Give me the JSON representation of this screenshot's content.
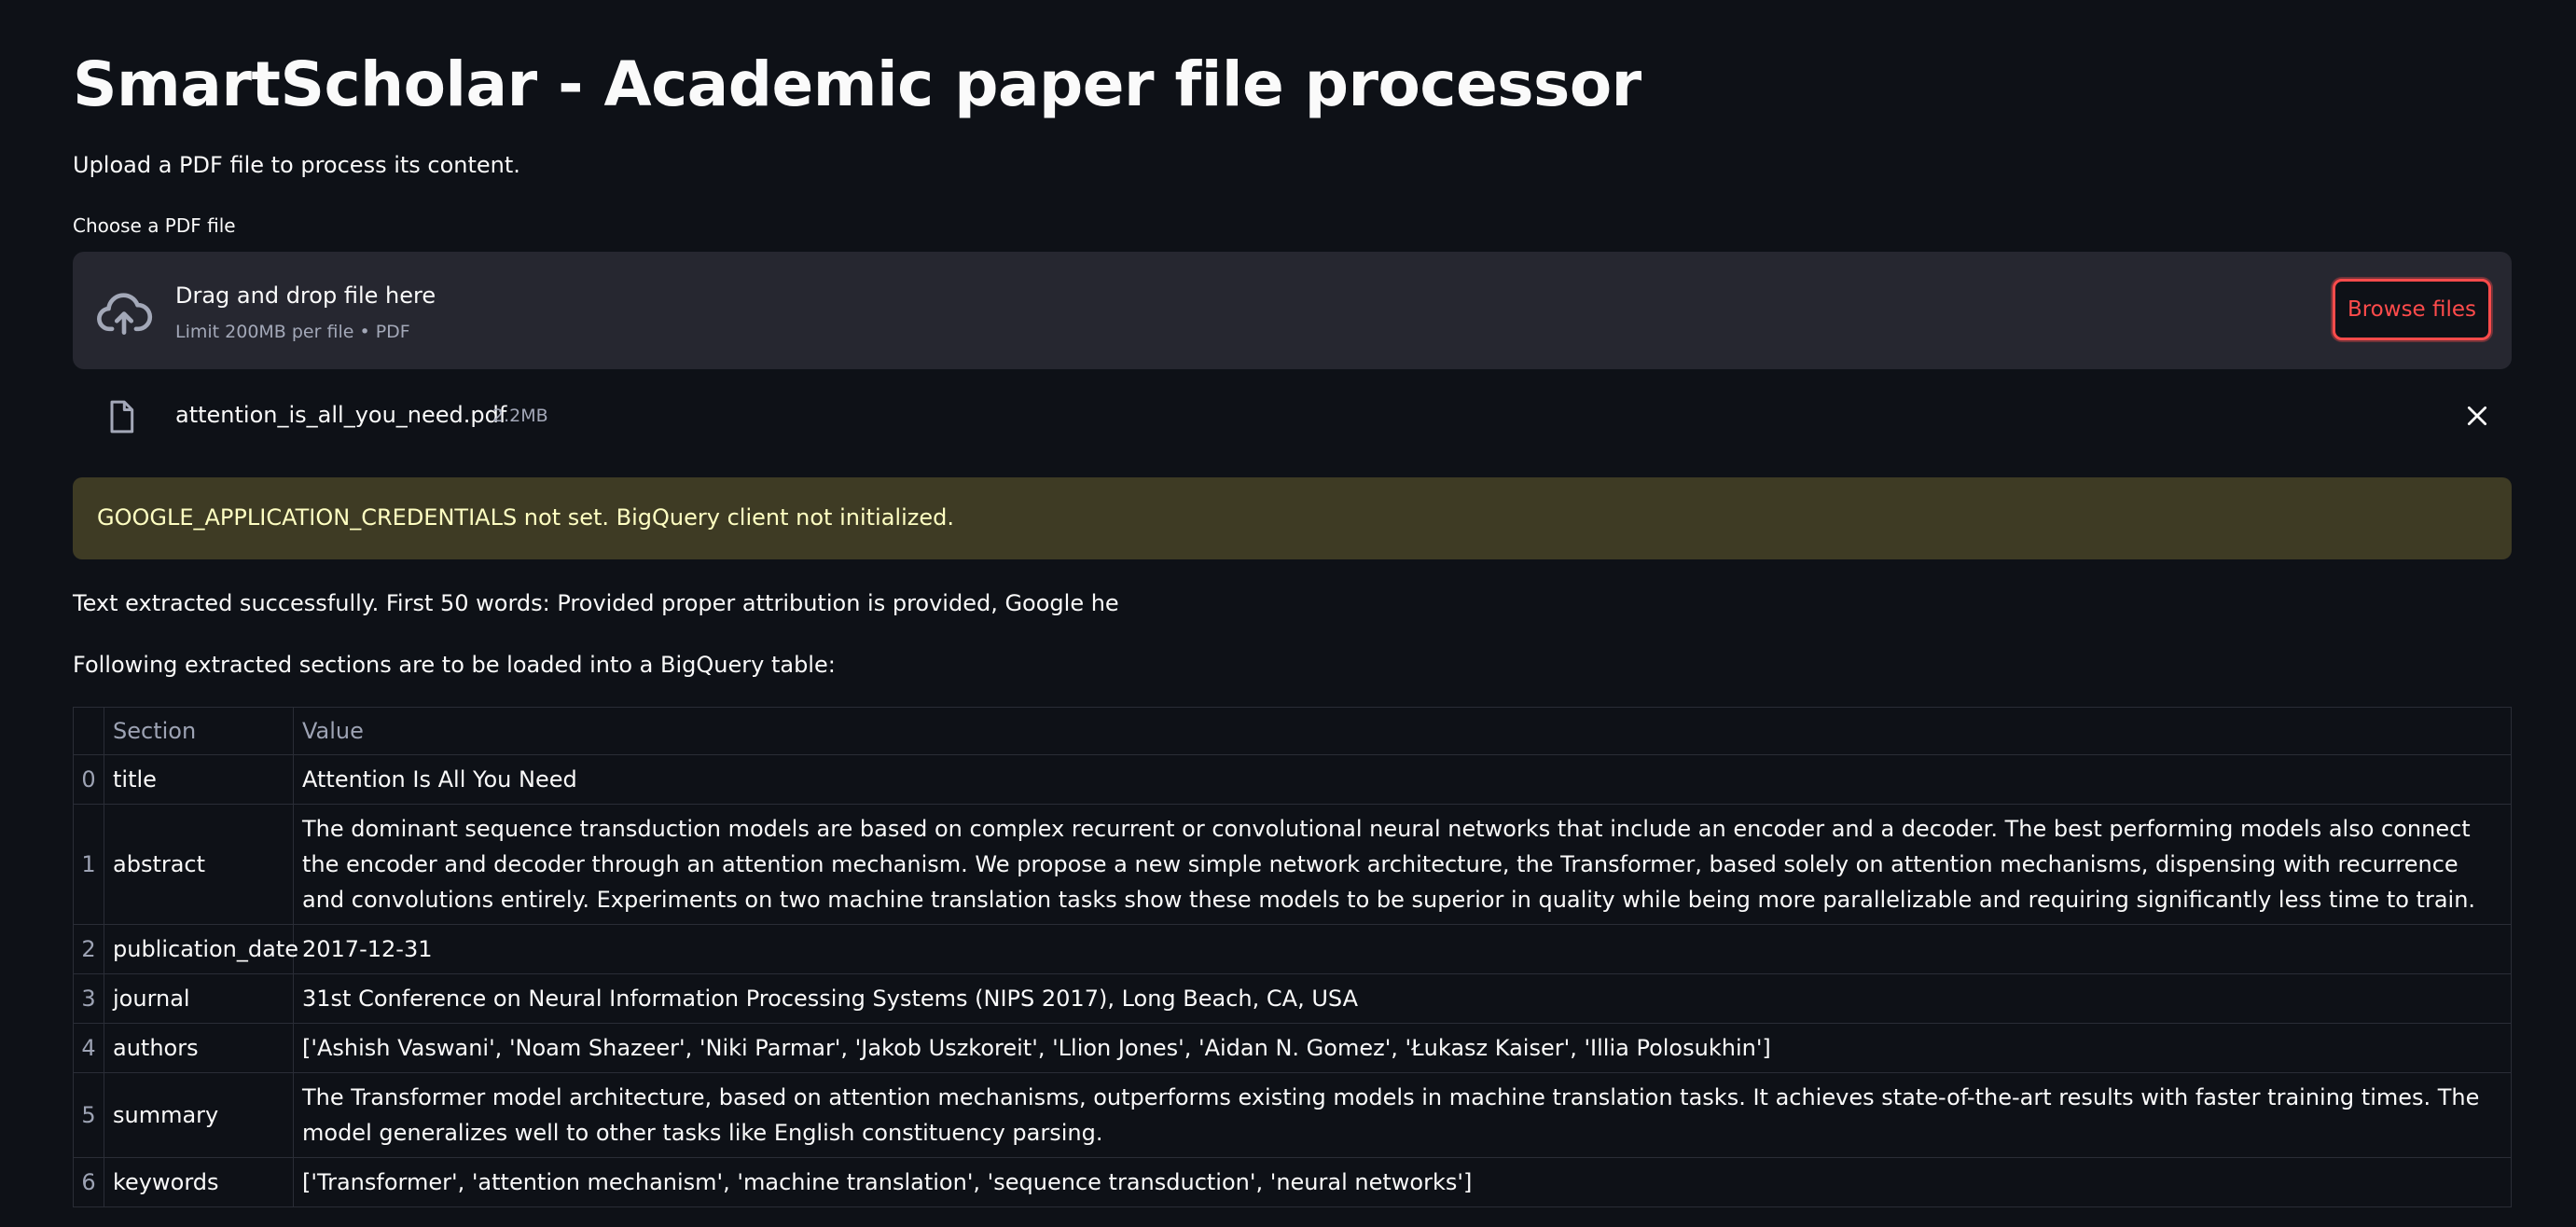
{
  "app": {
    "title": "SmartScholar - Academic paper file processor",
    "subtitle": "Upload a PDF file to process its content."
  },
  "uploader": {
    "label": "Choose a PDF file",
    "drop_title": "Drag and drop file here",
    "drop_limit": "Limit 200MB per file • PDF",
    "browse_label": "Browse files",
    "cloud_icon": "cloud-upload-icon"
  },
  "uploaded_file": {
    "icon": "file-icon",
    "name": "attention_is_all_you_need.pdf",
    "size": "2.2MB",
    "remove_icon": "close-icon"
  },
  "warning": {
    "text": "GOOGLE_APPLICATION_CREDENTIALS not set. BigQuery client not initialized.",
    "bg_color": "#3e3b24",
    "text_color": "#ffffc2"
  },
  "messages": {
    "extracted": "Text extracted successfully. First 50 words: Provided proper attribution is provided, Google he",
    "following": "Following extracted sections are to be loaded into a BigQuery table:"
  },
  "table": {
    "headers": [
      "",
      "Section",
      "Value"
    ],
    "rows": [
      {
        "index": "0",
        "section": "title",
        "value": "Attention Is All You Need"
      },
      {
        "index": "1",
        "section": "abstract",
        "value": "The dominant sequence transduction models are based on complex recurrent or convolutional neural networks that include an encoder and a decoder. The best performing models also connect the encoder and decoder through an attention mechanism. We propose a new simple network architecture, the Transformer, based solely on attention mechanisms, dispensing with recurrence and convolutions entirely. Experiments on two machine translation tasks show these models to be superior in quality while being more parallelizable and requiring significantly less time to train."
      },
      {
        "index": "2",
        "section": "publication_date",
        "value": "2017-12-31"
      },
      {
        "index": "3",
        "section": "journal",
        "value": "31st Conference on Neural Information Processing Systems (NIPS 2017), Long Beach, CA, USA"
      },
      {
        "index": "4",
        "section": "authors",
        "value": "['Ashish Vaswani', 'Noam Shazeer', 'Niki Parmar', 'Jakob Uszkoreit', 'Llion Jones', 'Aidan N. Gomez', 'Łukasz Kaiser', 'Illia Polosukhin']"
      },
      {
        "index": "5",
        "section": "summary",
        "value": "The Transformer model architecture, based on attention mechanisms, outperforms existing models in machine translation tasks. It achieves state-of-the-art results with faster training times. The model generalizes well to other tasks like English constituency parsing."
      },
      {
        "index": "6",
        "section": "keywords",
        "value": "['Transformer', 'attention mechanism', 'machine translation', 'sequence transduction', 'neural networks']"
      }
    ]
  },
  "colors": {
    "background": "#0e1117",
    "dropzone": "#262730",
    "accent": "#ff4b4b"
  }
}
